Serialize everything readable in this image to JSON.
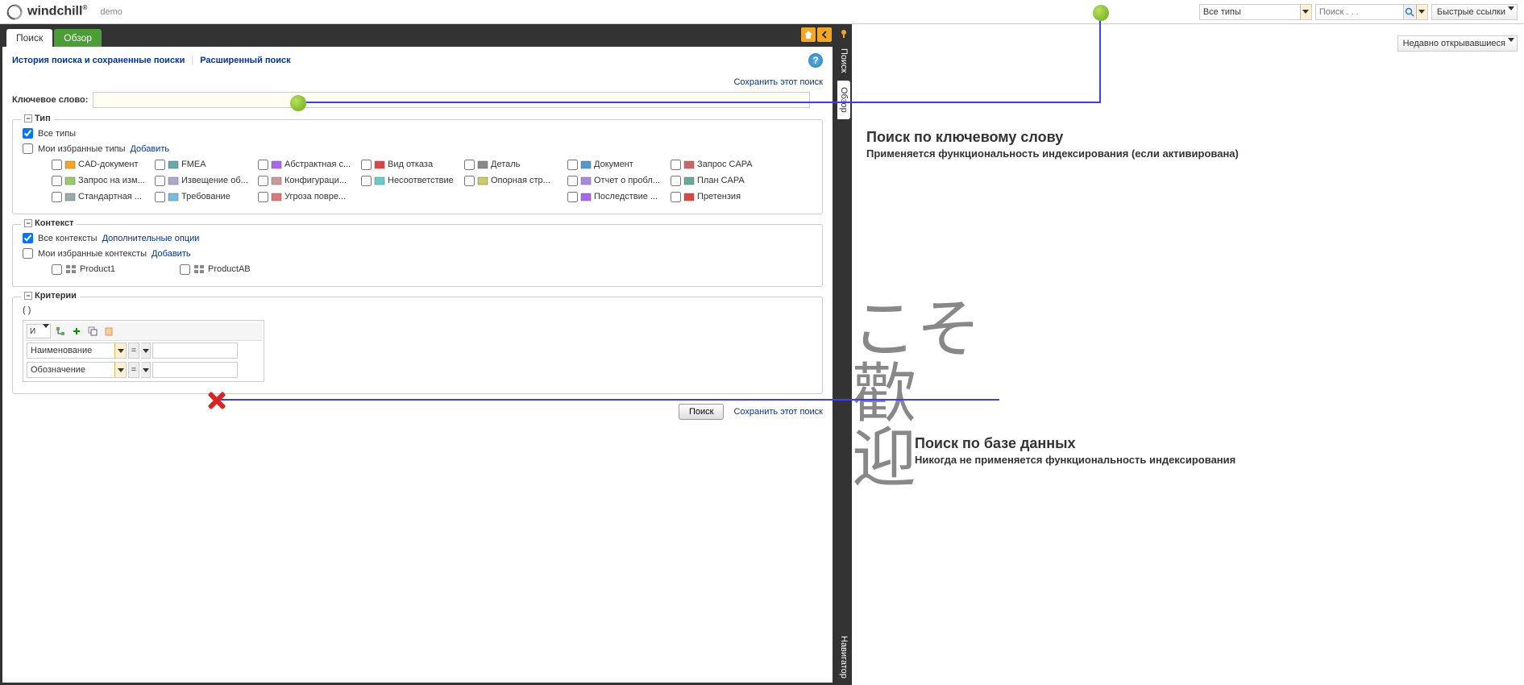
{
  "app": {
    "name": "windchill",
    "user": "demo"
  },
  "topbar": {
    "type_filter": "Все типы",
    "search_placeholder": "Поиск . . .",
    "quick_links": "Быстрые ссылки"
  },
  "tabs": {
    "search": "Поиск",
    "overview": "Обзор"
  },
  "links": {
    "history": "История поиска и сохраненные поиски",
    "advanced": "Расширенный поиск",
    "save_search": "Сохранить этот поиск"
  },
  "keyword": {
    "label": "Ключевое слово:"
  },
  "type_section": {
    "legend": "Тип",
    "all_types": "Все типы",
    "my_fav": "Мои избранные типы",
    "add": "Добавить",
    "items": [
      "CAD-документ",
      "FMEA",
      "Абстрактная с...",
      "Вид отказа",
      "Деталь",
      "Документ",
      "Запрос CAPA",
      "Запрос на изм...",
      "Извещение об...",
      "Конфигураци...",
      "Несоответствие",
      "Опорная стр...",
      "Отчет о пробл...",
      "План CAPA",
      "Стандартная ...",
      "Требование",
      "Угроза повре...",
      "",
      "",
      "Последствие ...",
      "Претензия"
    ]
  },
  "context_section": {
    "legend": "Контекст",
    "all": "Все контексты",
    "opts": "Дополнительные опции",
    "my_fav": "Мои избранные контексты",
    "add": "Добавить",
    "items": [
      "Product1",
      "ProductAB"
    ]
  },
  "criteria_section": {
    "legend": "Критерии",
    "parens": "( )",
    "and": "И",
    "rows": [
      {
        "field": "Наименование",
        "op": "="
      },
      {
        "field": "Обозначение",
        "op": "="
      }
    ]
  },
  "footer": {
    "search": "Поиск",
    "save": "Сохранить этот поиск"
  },
  "vtabs": {
    "search": "Поиск",
    "overview": "Обзор",
    "navigator": "Навигатор"
  },
  "right": {
    "recent": "Недавно открывавшиеся",
    "anno1_title": "Поиск по ключевому слову",
    "anno1_sub": "Применяется функциональность индексирования (если активирована)",
    "anno2_title": "Поиск по базе данных",
    "anno2_sub": "Никогда не применяется функциональность индексирования",
    "cjk": "こそ\n歡\n迎"
  }
}
